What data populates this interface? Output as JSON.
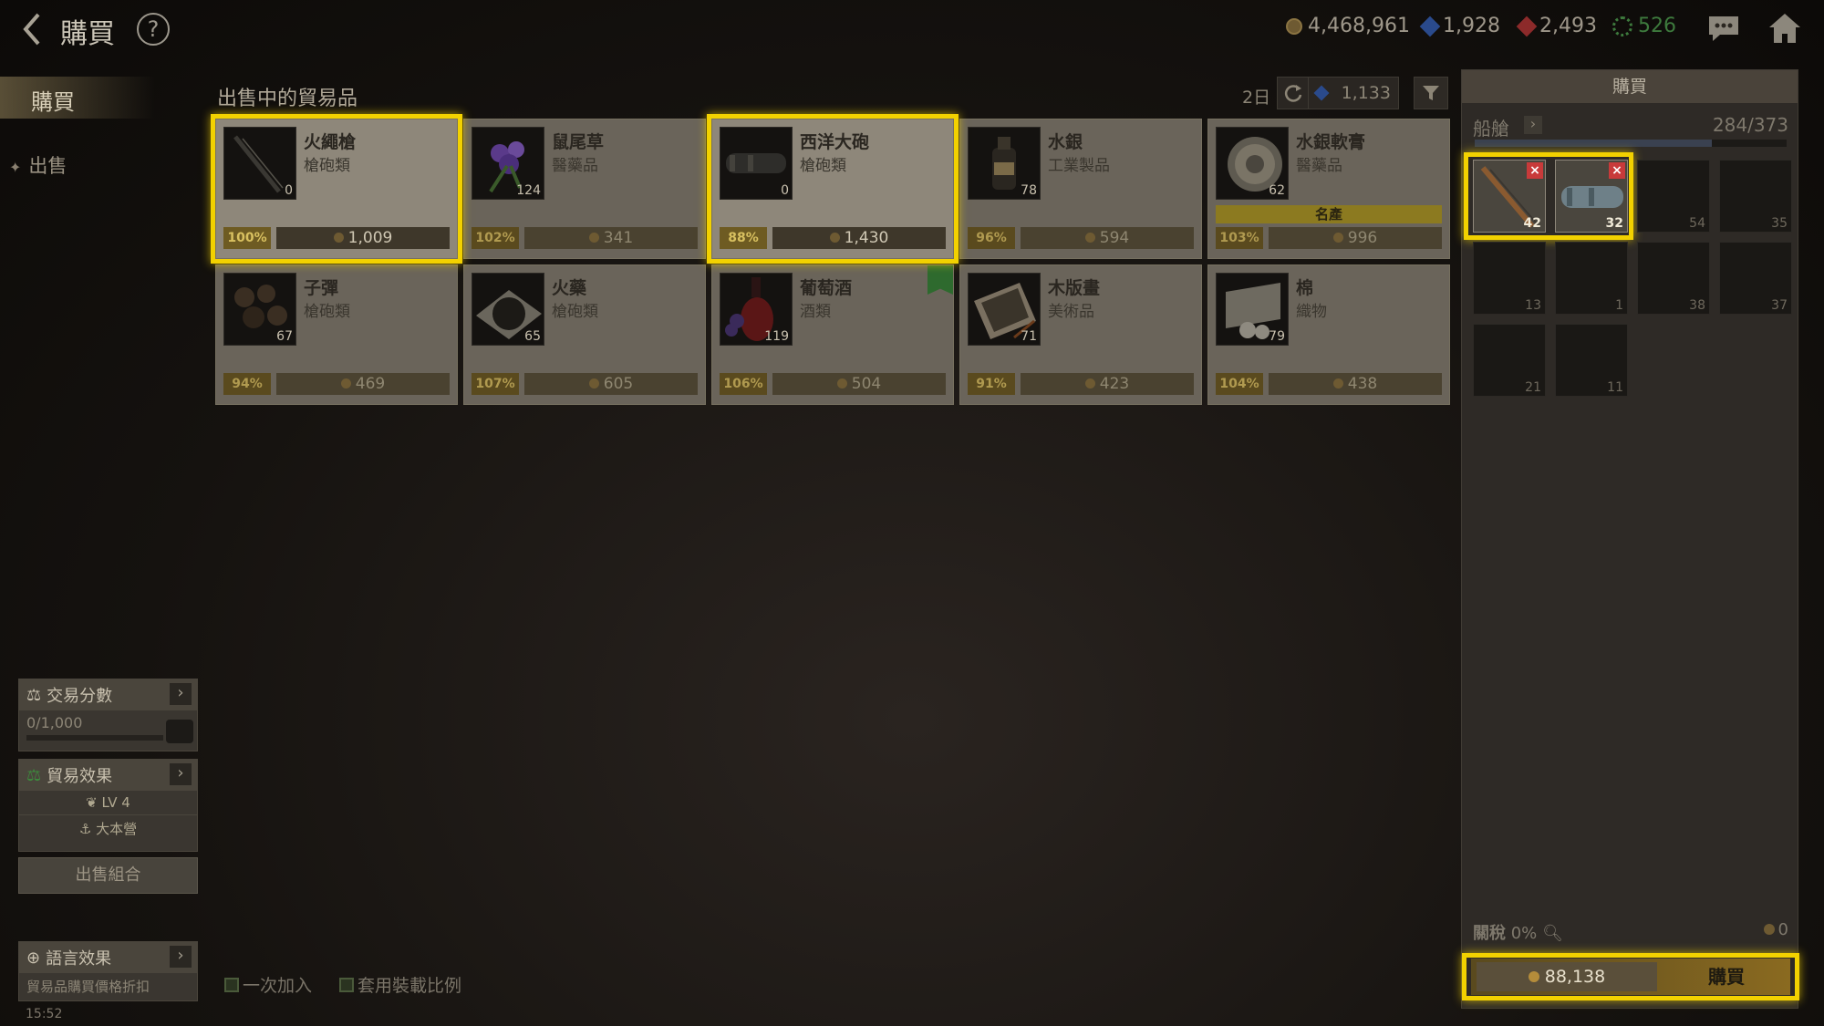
{
  "header": {
    "title": "購買",
    "help": "?",
    "currencies": [
      {
        "icon": "gold-coin-icon",
        "value": "4,468,961",
        "color": "#9e978a"
      },
      {
        "icon": "blue-gem-icon",
        "value": "1,928",
        "color": "#9e978a"
      },
      {
        "icon": "red-gem-icon",
        "value": "2,493",
        "color": "#9e978a"
      },
      {
        "icon": "ship-wheel-icon",
        "value": "526",
        "color": "#3d7a3d"
      }
    ]
  },
  "sidebar": {
    "tabs": [
      {
        "label": "購買",
        "active": true
      },
      {
        "label": "出售",
        "active": false
      }
    ],
    "trade_score": {
      "title": "交易分數",
      "value": "0/1,000"
    },
    "trade_effect": {
      "title": "貿易效果",
      "level": "LV 4",
      "base": "大本營"
    },
    "sell_combo": "出售組合",
    "language_effect": {
      "title": "語言效果",
      "desc": "貿易品購買價格折扣"
    },
    "clock": "15:52"
  },
  "market": {
    "title": "出售中的貿易品",
    "days": "2日",
    "refresh_cost": "1,133",
    "items": [
      {
        "name": "火繩槍",
        "category": "槍砲類",
        "qty": "0",
        "pct": "100%",
        "price": "1,009",
        "selected": true
      },
      {
        "name": "鼠尾草",
        "category": "醫藥品",
        "qty": "124",
        "pct": "102%",
        "price": "341"
      },
      {
        "name": "西洋大砲",
        "category": "槍砲類",
        "qty": "0",
        "pct": "88%",
        "price": "1,430",
        "selected": true
      },
      {
        "name": "水銀",
        "category": "工業製品",
        "qty": "78",
        "pct": "96%",
        "price": "594"
      },
      {
        "name": "水銀軟膏",
        "category": "醫藥品",
        "qty": "62",
        "pct": "103%",
        "price": "996",
        "badge": "名產"
      },
      {
        "name": "子彈",
        "category": "槍砲類",
        "qty": "67",
        "pct": "94%",
        "price": "469"
      },
      {
        "name": "火藥",
        "category": "槍砲類",
        "qty": "65",
        "pct": "107%",
        "price": "605"
      },
      {
        "name": "葡萄酒",
        "category": "酒類",
        "qty": "119",
        "pct": "106%",
        "price": "504",
        "flag": true
      },
      {
        "name": "木版畫",
        "category": "美術品",
        "qty": "71",
        "pct": "91%",
        "price": "423"
      },
      {
        "name": "棉",
        "category": "織物",
        "qty": "79",
        "pct": "104%",
        "price": "438"
      }
    ],
    "options": [
      "一次加入",
      "套用裝載比例"
    ]
  },
  "purchase": {
    "title": "購買",
    "hold_label": "船艙",
    "hold_capacity": "284/373",
    "hold_fraction": 0.761,
    "cart": [
      {
        "name": "火繩槍",
        "qty": "42"
      },
      {
        "name": "西洋大砲",
        "qty": "32"
      }
    ],
    "hold_slots": [
      "54",
      "35",
      "13",
      "1",
      "38",
      "37",
      "21",
      "11"
    ],
    "tax_label": "關稅",
    "tax_rate": "0%",
    "tax_amount": "0",
    "total": "88,138",
    "buy_label": "購買"
  }
}
